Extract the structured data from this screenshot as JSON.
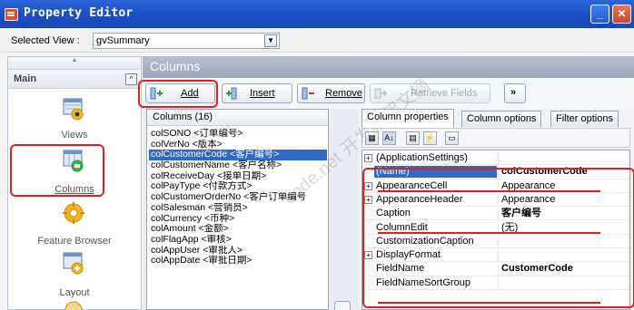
{
  "window": {
    "title": "Property Editor",
    "minimize_glyph": "_",
    "close_glyph": "✕"
  },
  "view_selector": {
    "label": "Selected View :",
    "value": "gvSummary"
  },
  "nav": {
    "group": "Main",
    "items": [
      {
        "label": "Views",
        "icon": "views-icon"
      },
      {
        "label": "Columns",
        "icon": "columns-icon"
      },
      {
        "label": "Feature Browser",
        "icon": "feature-browser-icon"
      },
      {
        "label": "Layout",
        "icon": "layout-icon"
      }
    ]
  },
  "main": {
    "header": "Columns",
    "toolbar": {
      "add": "Add",
      "insert": "Insert",
      "remove": "Remove",
      "retrieve": "Retrieve Fields",
      "more": "»"
    },
    "list": {
      "header": "Columns (16)",
      "items": [
        "colSONO <订单编号>",
        "colVerNo <版本>",
        "colCustomerCode <客户编号>",
        "colCustomerName <客户名称>",
        "colReceiveDay <接单日期>",
        "colPayType <付款方式>",
        "colCustomerOrderNo <客户订单编号",
        "colSalesman <营销员>",
        "colCurrency <币种>",
        "colAmount <金额>",
        "colFlagApp <审核>",
        "colAppUser <审批人>",
        "colAppDate <审批日期>"
      ],
      "selected_index": 2
    },
    "tabs": [
      "Column properties",
      "Column options",
      "Filter options"
    ],
    "properties": [
      {
        "name": "(ApplicationSettings)",
        "value": "",
        "expand": "+"
      },
      {
        "name": "(Name)",
        "value": "colCustomerCode",
        "expand": ""
      },
      {
        "name": "AppearanceCell",
        "value": "Appearance",
        "expand": "+"
      },
      {
        "name": "AppearanceHeader",
        "value": "Appearance",
        "expand": "+"
      },
      {
        "name": "Caption",
        "value": "客户编号",
        "expand": ""
      },
      {
        "name": "ColumnEdit",
        "value": "(无)",
        "expand": ""
      },
      {
        "name": "CustomizationCaption",
        "value": "",
        "expand": ""
      },
      {
        "name": "DisplayFormat",
        "value": "",
        "expand": "+"
      },
      {
        "name": "FieldName",
        "value": "CustomerCode",
        "expand": ""
      },
      {
        "name": "FieldNameSortGroup",
        "value": "",
        "expand": ""
      }
    ]
  },
  "watermark": "code.net 开发框架文摘",
  "colors": {
    "title_blue": "#1a4fc4",
    "selection": "#3169c6",
    "annotation_red": "#e02020"
  }
}
